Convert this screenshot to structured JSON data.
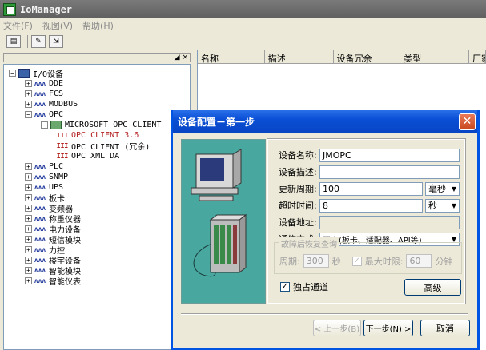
{
  "window": {
    "title": "IoManager"
  },
  "menu": [
    "文件(F)",
    "视图(V)",
    "帮助(H)"
  ],
  "tree": {
    "pane_close": "◢ ×",
    "root": "I/O设备",
    "items": [
      {
        "label": "DDE",
        "icon": "network-icon"
      },
      {
        "label": "FCS",
        "icon": "network-icon"
      },
      {
        "label": "MODBUS",
        "icon": "network-icon"
      },
      {
        "label": "OPC",
        "icon": "network-icon"
      }
    ],
    "opc_server": "MICROSOFT OPC CLIENT",
    "opc_children": [
      "OPC CLIENT 3.6",
      "OPC CLIENT (冗余)",
      "OPC XML DA"
    ],
    "more_items": [
      "PLC",
      "SNMP",
      "UPS",
      "板卡",
      "变频器",
      "称重仪器",
      "电力设备",
      "短信模块",
      "力控",
      "楼宇设备",
      "智能模块",
      "智能仪表"
    ]
  },
  "list": {
    "columns": [
      "名称",
      "描述",
      "设备冗余",
      "类型",
      "厂家"
    ]
  },
  "dialog": {
    "title": "设备配置－第一步",
    "close": "✕",
    "name_label": "设备名称:",
    "name_value": "JMOPC",
    "desc_label": "设备描述:",
    "desc_value": "",
    "period_label": "更新周期:",
    "period_value": "100",
    "period_unit": "毫秒",
    "timeout_label": "超时时间:",
    "timeout_value": "8",
    "timeout_unit": "秒",
    "addr_label": "设备地址:",
    "addr_value": "",
    "mode_label": "通信方式:",
    "mode_value": "同步(板卡、适配器、API等)",
    "recover_title": "故障后恢复查询",
    "recover_period_label": "周期:",
    "recover_period_value": "300",
    "recover_period_unit": "秒",
    "max_time_label": "最大时限:",
    "max_time_value": "60",
    "max_time_unit": "分钟",
    "exclusive_label": "独占通道",
    "advanced_btn": "高级",
    "prev_btn": "< 上一步(B)",
    "next_btn": "下一步(N) >",
    "cancel_btn": "取消"
  }
}
